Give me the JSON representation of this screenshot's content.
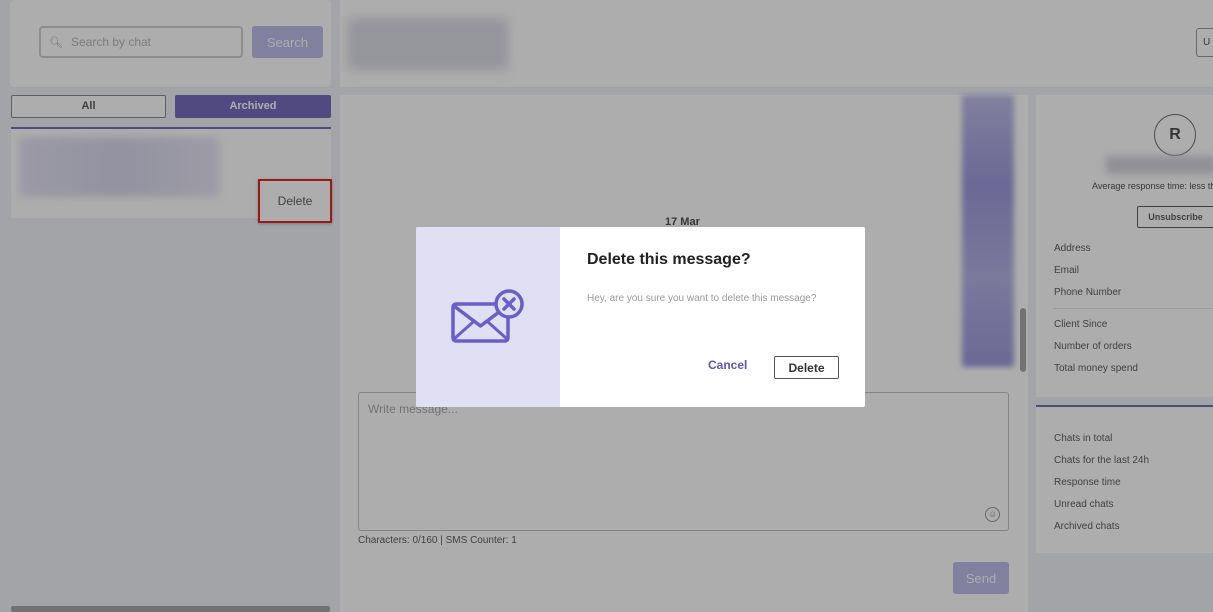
{
  "sidebar": {
    "search": {
      "placeholder": "Search by chat",
      "value": "",
      "button_label": "Search"
    },
    "tabs": {
      "all": "All",
      "archived": "Archived"
    },
    "chat_item": {
      "delete_label": "Delete"
    }
  },
  "header": {
    "button_label": "U"
  },
  "chat": {
    "date_label": "17 Mar",
    "input_placeholder": "Write message...",
    "counter_text": "Characters: 0/160 | SMS Counter: 1",
    "send_label": "Send",
    "emoji_icon": "smiley-icon"
  },
  "profile": {
    "avatar_initial": "R",
    "avg_response": "Average response time: less tha",
    "unsubscribe_label": "Unsubscribe",
    "contact_fields": [
      "Address",
      "Email",
      "Phone Number"
    ],
    "client_fields": [
      "Client Since",
      "Number of orders",
      "Total money spend"
    ],
    "stats_fields": [
      "Chats in total",
      "Chats for the last 24h",
      "Response time",
      "Unread chats",
      "Archived chats"
    ]
  },
  "modal": {
    "title": "Delete this message?",
    "text": "Hey, are you sure you want to delete this message?",
    "cancel_label": "Cancel",
    "delete_label": "Delete",
    "icon": "envelope-delete-icon"
  },
  "colors": {
    "accent": "#5f55b4",
    "accent_light": "#b3b1e6",
    "highlight": "#d90000"
  }
}
